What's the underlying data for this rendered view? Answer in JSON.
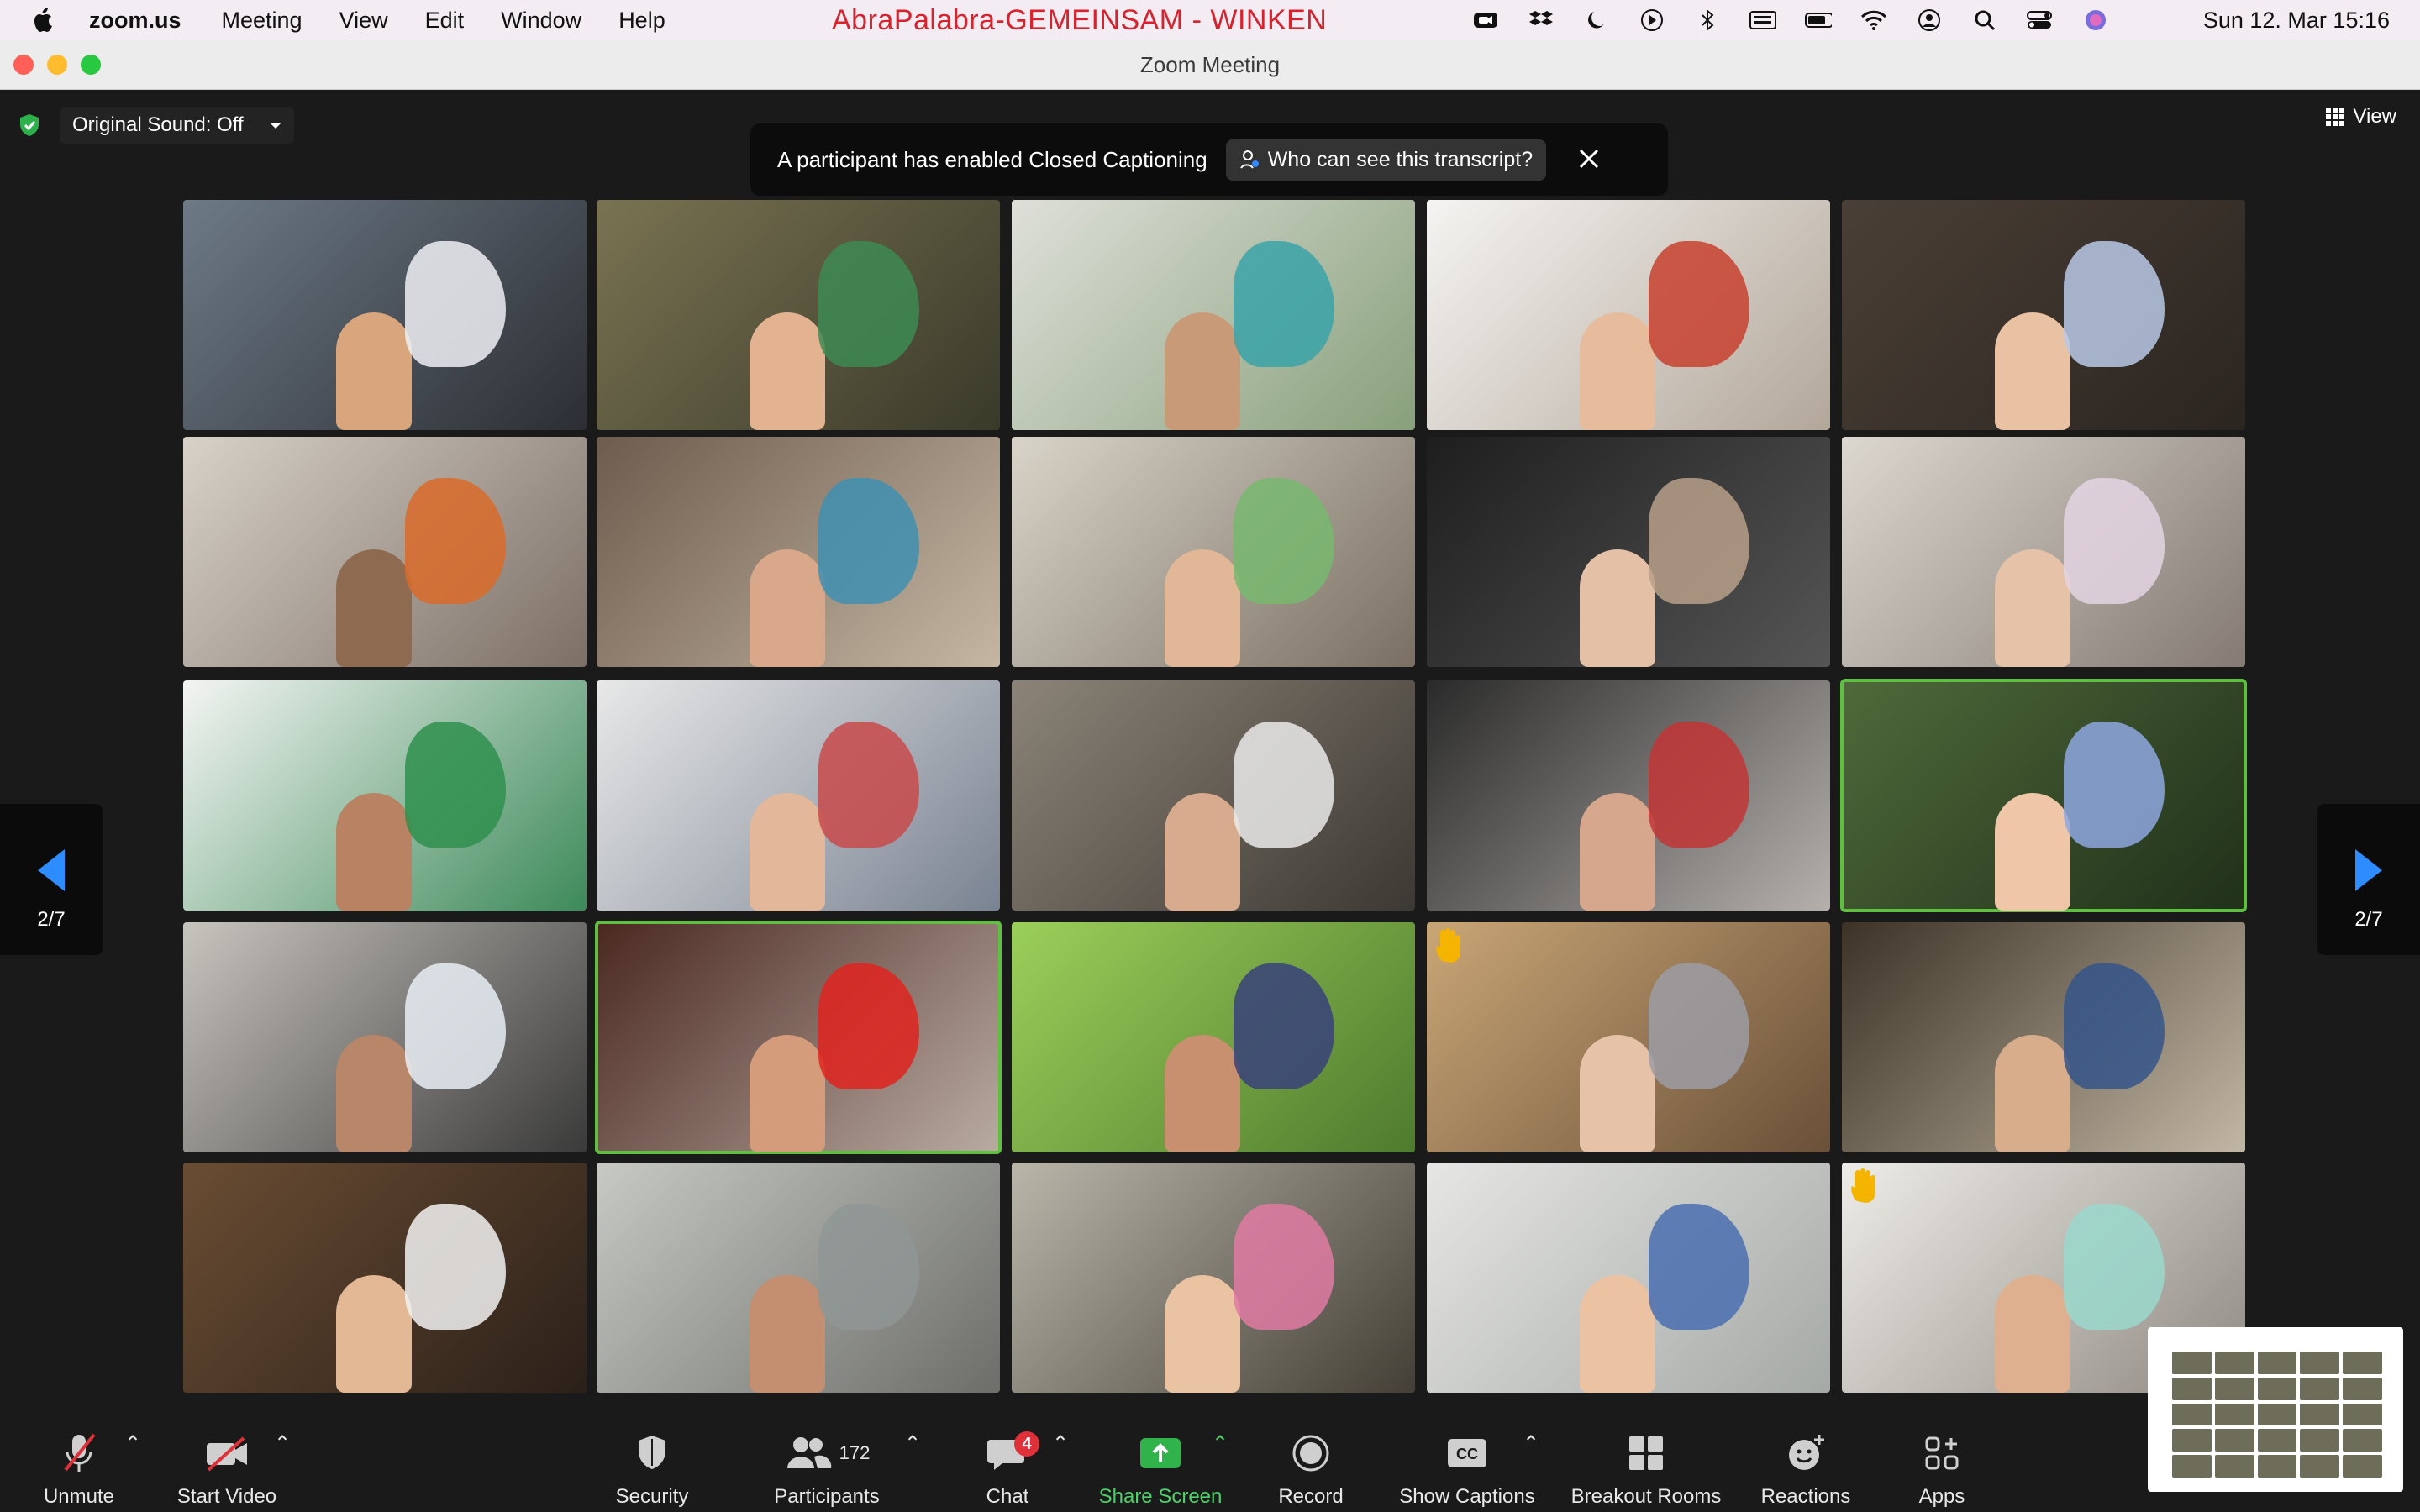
{
  "menubar": {
    "app_name": "zoom.us",
    "items": [
      "Meeting",
      "View",
      "Edit",
      "Window",
      "Help"
    ],
    "meeting_title": "AbraPalabra-GEMEINSAM - WINKEN",
    "clock": "Sun 12. Mar  15:16"
  },
  "window": {
    "title": "Zoom Meeting"
  },
  "meeting": {
    "original_sound_label": "Original Sound: Off",
    "view_label": "View",
    "cc_banner": {
      "message": "A participant has enabled Closed Captioning",
      "who_button": "Who can see this transcript?"
    },
    "page_indicator_left": "2/7",
    "page_indicator_right": "2/7",
    "tiles": [
      {
        "c1": "#6d7a86",
        "c2": "#2c2e34",
        "skin": "#d8a57c",
        "fab": "#eef0f4"
      },
      {
        "c1": "#7a7352",
        "c2": "#3a3a2a",
        "skin": "#e3b391",
        "fab": "#3d8a53"
      },
      {
        "c1": "#dfe0da",
        "c2": "#88a07b",
        "skin": "#c99a77",
        "fab": "#3aa3a8"
      },
      {
        "c1": "#f5f4f2",
        "c2": "#b3a79a",
        "skin": "#e6bc9d",
        "fab": "#c8412f"
      },
      {
        "c1": "#4a3f36",
        "c2": "#2b2520",
        "skin": "#e9c2a4",
        "fab": "#b9c9e6"
      },
      {
        "c1": "#d8d2c8",
        "c2": "#7c6f66",
        "skin": "#8e6a50",
        "fab": "#d96b2a"
      },
      {
        "c1": "#6e5c4e",
        "c2": "#c5b6a3",
        "skin": "#d9a88a",
        "fab": "#3f8fb0"
      },
      {
        "c1": "#d9d4c9",
        "c2": "#7a6f62",
        "skin": "#e2b797",
        "fab": "#78b86f"
      },
      {
        "c1": "#1e1e1e",
        "c2": "#555",
        "skin": "#e4c1a6",
        "fab": "#b89f8a"
      },
      {
        "c1": "#dcd7cf",
        "c2": "#847a73",
        "skin": "#e6c3a8",
        "fab": "#e4d5e3"
      },
      {
        "c1": "#f4f5f3",
        "c2": "#3d8a5a",
        "skin": "#b98262",
        "fab": "#2f8f4d"
      },
      {
        "c1": "#e8e8e8",
        "c2": "#7a8392",
        "skin": "#e3b89a",
        "fab": "#c84a4a"
      },
      {
        "c1": "#8c8478",
        "c2": "#3c3833",
        "skin": "#d9ab8e",
        "fab": "#eaeaea"
      },
      {
        "c1": "#2a2a2a",
        "c2": "#b5b0ac",
        "skin": "#d6a78c",
        "fab": "#c23535"
      },
      {
        "c1": "#4f6a3a",
        "c2": "#20301a",
        "skin": "#efc7a8",
        "fab": "#8ea7e0"
      },
      {
        "c1": "#c8c4be",
        "c2": "#3a3a3a",
        "skin": "#b88668",
        "fab": "#e8eef4"
      },
      {
        "c1": "#4a2820",
        "c2": "#b9aba2",
        "skin": "#d59c7c",
        "fab": "#e0231f"
      },
      {
        "c1": "#9bcf5a",
        "c2": "#4f7b2e",
        "skin": "#c99070",
        "fab": "#38427a"
      },
      {
        "c1": "#c9a676",
        "c2": "#6a5038",
        "skin": "#e6c2a8",
        "fab": "#9c9ca4"
      },
      {
        "c1": "#3c3226",
        "c2": "#c2b7a4",
        "skin": "#d8ad8c",
        "fab": "#34558a"
      },
      {
        "c1": "#6a4d33",
        "c2": "#2b2019",
        "skin": "#e3b895",
        "fab": "#f2f2f2"
      },
      {
        "c1": "#c7c9c4",
        "c2": "#6d6e69",
        "skin": "#c48e70",
        "fab": "#8f9795"
      },
      {
        "c1": "#b9b6aa",
        "c2": "#433f36",
        "skin": "#eac3a3",
        "fab": "#e07aa2"
      },
      {
        "c1": "#e6e6e4",
        "c2": "#a5a9a6",
        "skin": "#ebc3a3",
        "fab": "#4a6fb0"
      },
      {
        "c1": "#eeece8",
        "c2": "#8f8a82",
        "skin": "#dfb08f",
        "fab": "#9ad8cc"
      }
    ]
  },
  "toolbar": {
    "unmute": "Unmute",
    "start_video": "Start Video",
    "security": "Security",
    "participants": "Participants",
    "participants_count": "172",
    "chat": "Chat",
    "chat_badge": "4",
    "share_screen": "Share Screen",
    "record": "Record",
    "show_captions": "Show Captions",
    "breakout_rooms": "Breakout Rooms",
    "reactions": "Reactions",
    "apps": "Apps"
  }
}
